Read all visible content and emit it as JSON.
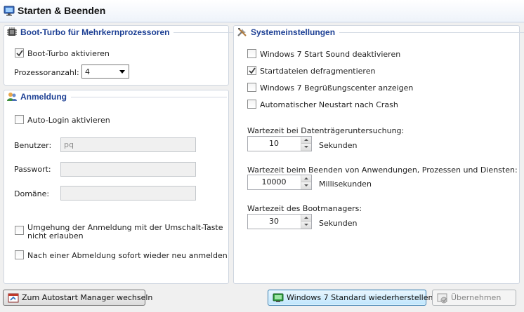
{
  "window": {
    "title": "Starten & Beenden"
  },
  "boot_turbo": {
    "title": "Boot-Turbo für Mehrkernprozessoren",
    "enable_label": "Boot-Turbo aktivieren",
    "enable_checked": true,
    "cores_label": "Prozessoranzahl:",
    "cores_value": "4"
  },
  "login": {
    "title": "Anmeldung",
    "autologin_label": "Auto-Login aktivieren",
    "autologin_checked": false,
    "user_label": "Benutzer:",
    "user_value": "pq",
    "password_label": "Passwort:",
    "password_value": "",
    "domain_label": "Domäne:",
    "domain_value": "",
    "shift_bypass_line1": "Umgehung der Anmeldung mit der Umschalt-Taste",
    "shift_bypass_line2": "nicht erlauben",
    "shift_bypass_checked": false,
    "relogin_label": "Nach einer Abmeldung sofort wieder neu anmelden",
    "relogin_checked": false
  },
  "system": {
    "title": "Systemeinstellungen",
    "options": [
      {
        "label": "Windows 7 Start Sound deaktivieren",
        "checked": false
      },
      {
        "label": "Startdateien defragmentieren",
        "checked": true
      },
      {
        "label": "Windows 7 Begrüßungscenter anzeigen",
        "checked": false
      },
      {
        "label": "Automatischer Neustart nach Crash",
        "checked": false
      }
    ],
    "disk_check_label": "Wartezeit bei Datenträgeruntersuchung:",
    "disk_check_value": "10",
    "disk_check_unit": "Sekunden",
    "app_close_label": "Wartezeit beim Beenden von Anwendungen, Prozessen und Diensten:",
    "app_close_value": "10000",
    "app_close_unit": "Millisekunden",
    "bootmgr_label": "Wartezeit des Bootmanagers:",
    "bootmgr_value": "30",
    "bootmgr_unit": "Sekunden"
  },
  "footer": {
    "autostart_label": "Zum Autostart Manager wechseln",
    "restore_label": "Windows 7 Standard wiederherstellen",
    "apply_label": "Übernehmen"
  },
  "colors": {
    "section_title": "#1c3f94",
    "accent_button": "#bee6fd"
  }
}
